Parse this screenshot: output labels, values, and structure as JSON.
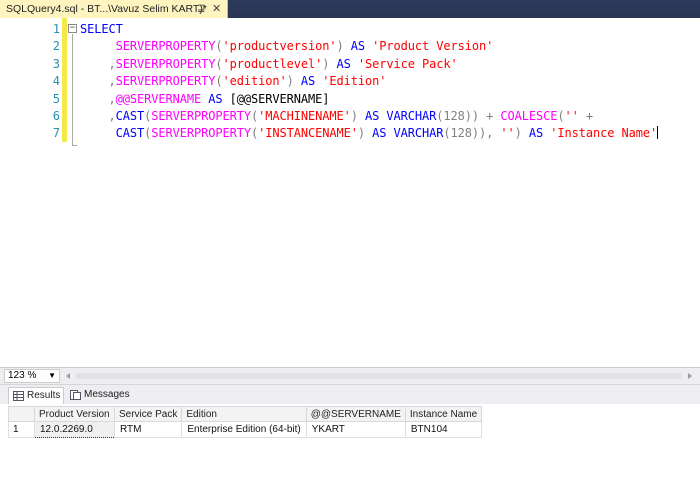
{
  "tab": {
    "title": "SQLQuery4.sql - BT...\\Vavuz Selim KART)*",
    "pin": "⊒",
    "close": "✕"
  },
  "editor": {
    "line_numbers": [
      "1",
      "2",
      "3",
      "4",
      "5",
      "6",
      "7"
    ],
    "lines": [
      [
        {
          "t": "SELECT",
          "c": "kw"
        }
      ],
      [
        {
          "t": "     ",
          "c": ""
        },
        {
          "t": "SERVERPROPERTY",
          "c": "fn"
        },
        {
          "t": "(",
          "c": "op"
        },
        {
          "t": "'productversion'",
          "c": "str"
        },
        {
          "t": ")",
          "c": "op"
        },
        {
          "t": " AS ",
          "c": "kw"
        },
        {
          "t": "'Product Version'",
          "c": "str"
        }
      ],
      [
        {
          "t": "    ",
          "c": ""
        },
        {
          "t": ",",
          "c": "op"
        },
        {
          "t": "SERVERPROPERTY",
          "c": "fn"
        },
        {
          "t": "(",
          "c": "op"
        },
        {
          "t": "'productlevel'",
          "c": "str"
        },
        {
          "t": ")",
          "c": "op"
        },
        {
          "t": " AS ",
          "c": "kw"
        },
        {
          "t": "'Service Pack'",
          "c": "str"
        }
      ],
      [
        {
          "t": "    ",
          "c": ""
        },
        {
          "t": ",",
          "c": "op"
        },
        {
          "t": "SERVERPROPERTY",
          "c": "fn"
        },
        {
          "t": "(",
          "c": "op"
        },
        {
          "t": "'edition'",
          "c": "str"
        },
        {
          "t": ")",
          "c": "op"
        },
        {
          "t": " AS ",
          "c": "kw"
        },
        {
          "t": "'Edition'",
          "c": "str"
        }
      ],
      [
        {
          "t": "    ",
          "c": ""
        },
        {
          "t": ",",
          "c": "op"
        },
        {
          "t": "@@SERVERNAME",
          "c": "sys"
        },
        {
          "t": " AS ",
          "c": "kw"
        },
        {
          "t": "[@@SERVERNAME]",
          "c": ""
        }
      ],
      [
        {
          "t": "    ",
          "c": ""
        },
        {
          "t": ",",
          "c": "op"
        },
        {
          "t": "CAST",
          "c": "kw"
        },
        {
          "t": "(",
          "c": "op"
        },
        {
          "t": "SERVERPROPERTY",
          "c": "fn"
        },
        {
          "t": "(",
          "c": "op"
        },
        {
          "t": "'MACHINENAME'",
          "c": "str"
        },
        {
          "t": ")",
          "c": "op"
        },
        {
          "t": " AS ",
          "c": "kw"
        },
        {
          "t": "VARCHAR",
          "c": "kw"
        },
        {
          "t": "(128))",
          "c": "op"
        },
        {
          "t": " + ",
          "c": "op"
        },
        {
          "t": "COALESCE",
          "c": "fn"
        },
        {
          "t": "(",
          "c": "op"
        },
        {
          "t": "''",
          "c": "str"
        },
        {
          "t": " +",
          "c": "op"
        }
      ],
      [
        {
          "t": "     ",
          "c": ""
        },
        {
          "t": "CAST",
          "c": "kw"
        },
        {
          "t": "(",
          "c": "op"
        },
        {
          "t": "SERVERPROPERTY",
          "c": "fn"
        },
        {
          "t": "(",
          "c": "op"
        },
        {
          "t": "'INSTANCENAME'",
          "c": "str"
        },
        {
          "t": ")",
          "c": "op"
        },
        {
          "t": " AS ",
          "c": "kw"
        },
        {
          "t": "VARCHAR",
          "c": "kw"
        },
        {
          "t": "(128)),",
          "c": "op"
        },
        {
          "t": " ",
          "c": ""
        },
        {
          "t": "''",
          "c": "str"
        },
        {
          "t": ")",
          "c": "op"
        },
        {
          "t": " AS ",
          "c": "kw"
        },
        {
          "t": "'Instance Name'",
          "c": "str"
        }
      ]
    ]
  },
  "zoom": {
    "value": "123 %"
  },
  "results_tabs": [
    {
      "label": "Results",
      "active": true
    },
    {
      "label": "Messages",
      "active": false
    }
  ],
  "grid": {
    "columns": [
      "Product Version",
      "Service Pack",
      "Edition",
      "@@SERVERNAME",
      "Instance Name"
    ],
    "rows": [
      {
        "num": "1",
        "cells": [
          "12.0.2269.0",
          "RTM",
          "Enterprise Edition (64-bit)",
          "YKART",
          "BTN104"
        ]
      }
    ]
  },
  "colors": {
    "keyword": "#0000ff",
    "function": "#ff00ff",
    "string": "#ff0000",
    "operator": "#808080",
    "line_number": "#2b91af",
    "change_bar": "#f4e94a",
    "tab_active": "#fdf4bf"
  }
}
